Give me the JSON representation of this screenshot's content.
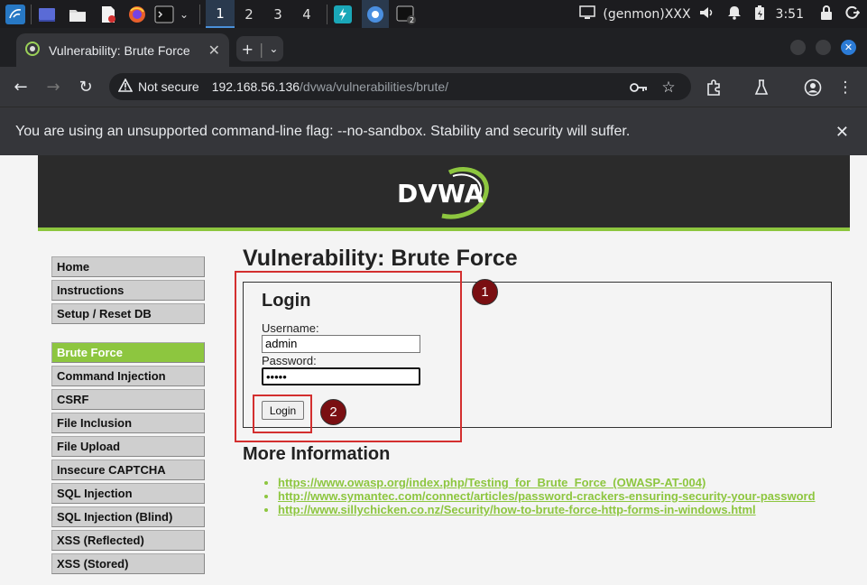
{
  "taskbar": {
    "workspaces": [
      "1",
      "2",
      "3",
      "4"
    ],
    "user_label": "(genmon)XXX",
    "clock": "3:51"
  },
  "browser": {
    "tab_title": "Vulnerability: Brute Force",
    "security_label": "Not secure",
    "url_host": "192.168.56.136",
    "url_path": "/dvwa/vulnerabilities/brute/",
    "infobar_text": "You are using an unsupported command-line flag: --no-sandbox. Stability and security will suffer."
  },
  "dvwa": {
    "logo_text": "DVWA",
    "menu_group1": [
      "Home",
      "Instructions",
      "Setup / Reset DB"
    ],
    "menu_group2": [
      "Brute Force",
      "Command Injection",
      "CSRF",
      "File Inclusion",
      "File Upload",
      "Insecure CAPTCHA",
      "SQL Injection",
      "SQL Injection (Blind)",
      "XSS (Reflected)",
      "XSS (Stored)"
    ],
    "page_title": "Vulnerability: Brute Force",
    "login_heading": "Login",
    "username_label": "Username:",
    "username_value": "admin",
    "password_label": "Password:",
    "password_value": "•••••",
    "login_button": "Login",
    "more_info_heading": "More Information",
    "links": [
      "https://www.owasp.org/index.php/Testing_for_Brute_Force_(OWASP-AT-004)",
      "http://www.symantec.com/connect/articles/password-crackers-ensuring-security-your-password",
      "http://www.sillychicken.co.nz/Security/how-to-brute-force-http-forms-in-windows.html"
    ]
  },
  "annotations": [
    "1",
    "2"
  ],
  "colors": {
    "accent_green": "#8dc63f",
    "annotation_red": "#d32f2f",
    "annotation_badge": "#7a0f12"
  }
}
